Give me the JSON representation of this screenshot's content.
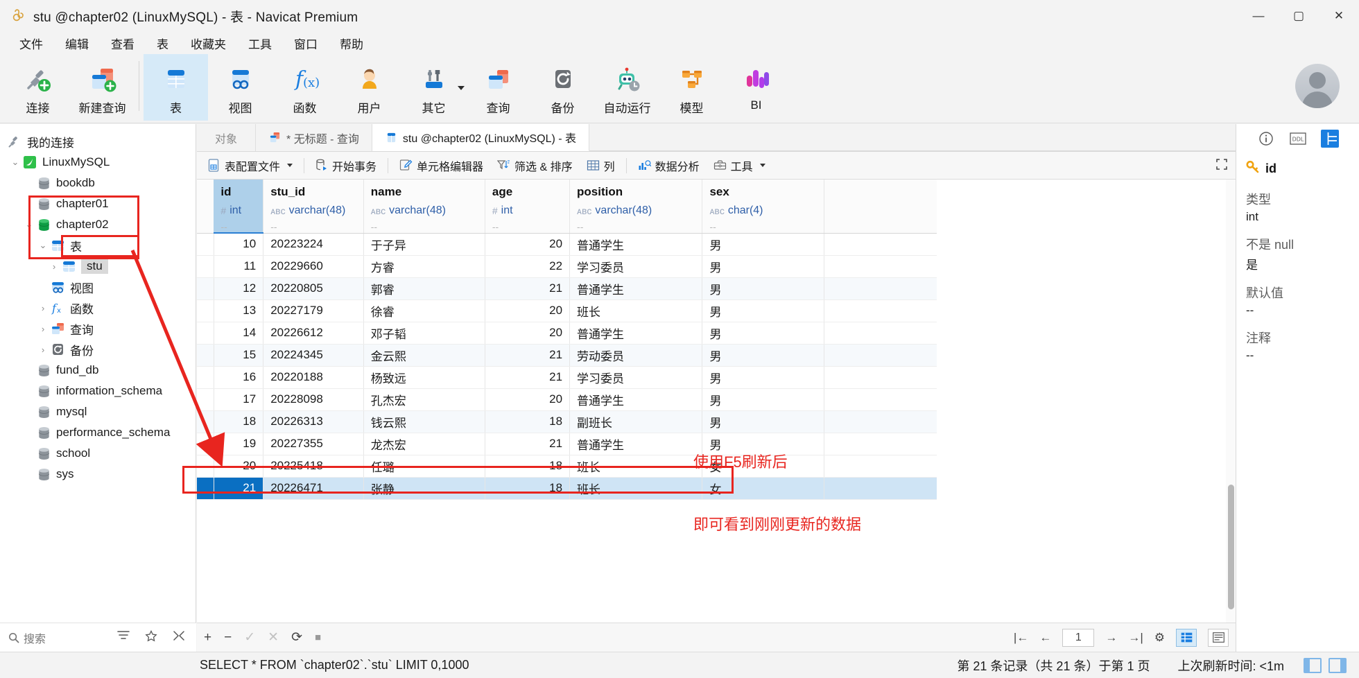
{
  "window": {
    "title": "stu @chapter02 (LinuxMySQL) - 表 - Navicat Premium",
    "minimize": "—",
    "maximize": "▢",
    "close": "✕"
  },
  "menubar": [
    "文件",
    "编辑",
    "查看",
    "表",
    "收藏夹",
    "工具",
    "窗口",
    "帮助"
  ],
  "toolbar": [
    {
      "label": "连接",
      "icon": "connection-add-icon"
    },
    {
      "label": "新建查询",
      "icon": "new-query-icon"
    },
    {
      "label": "表",
      "icon": "table-icon",
      "active": true
    },
    {
      "label": "视图",
      "icon": "view-icon"
    },
    {
      "label": "函数",
      "icon": "function-icon"
    },
    {
      "label": "用户",
      "icon": "user-icon"
    },
    {
      "label": "其它",
      "icon": "others-icon",
      "caret": true
    },
    {
      "label": "查询",
      "icon": "query-icon"
    },
    {
      "label": "备份",
      "icon": "backup-icon"
    },
    {
      "label": "自动运行",
      "icon": "automation-icon"
    },
    {
      "label": "模型",
      "icon": "model-icon"
    },
    {
      "label": "BI",
      "icon": "bi-icon"
    }
  ],
  "sidebar": {
    "root": "我的连接",
    "search_placeholder": "搜索",
    "tree": [
      {
        "label": "LinuxMySQL",
        "icon": "mysql-icon",
        "depth": 0,
        "arrow": "v"
      },
      {
        "label": "bookdb",
        "icon": "database-icon",
        "depth": 1,
        "arrow": ""
      },
      {
        "label": "chapter01",
        "icon": "database-icon",
        "depth": 1,
        "arrow": ""
      },
      {
        "label": "chapter02",
        "icon": "database-open-icon",
        "depth": 1,
        "arrow": "v"
      },
      {
        "label": "表",
        "icon": "table-folder-icon",
        "depth": 2,
        "arrow": "v"
      },
      {
        "label": "stu",
        "icon": "table-icon",
        "depth": 3,
        "arrow": ">",
        "selected": true
      },
      {
        "label": "视图",
        "icon": "view-folder-icon",
        "depth": 2,
        "arrow": ""
      },
      {
        "label": "函数",
        "icon": "function-folder-icon",
        "depth": 2,
        "arrow": ">"
      },
      {
        "label": "查询",
        "icon": "query-folder-icon",
        "depth": 2,
        "arrow": ">"
      },
      {
        "label": "备份",
        "icon": "backup-folder-icon",
        "depth": 2,
        "arrow": ">"
      },
      {
        "label": "fund_db",
        "icon": "database-icon",
        "depth": 1,
        "arrow": ""
      },
      {
        "label": "information_schema",
        "icon": "database-icon",
        "depth": 1,
        "arrow": ""
      },
      {
        "label": "mysql",
        "icon": "database-icon",
        "depth": 1,
        "arrow": ""
      },
      {
        "label": "performance_schema",
        "icon": "database-icon",
        "depth": 1,
        "arrow": ""
      },
      {
        "label": "school",
        "icon": "database-icon",
        "depth": 1,
        "arrow": ""
      },
      {
        "label": "sys",
        "icon": "database-icon",
        "depth": 1,
        "arrow": ""
      }
    ]
  },
  "doc_tabs": [
    {
      "label": "对象",
      "icon": "",
      "active": false
    },
    {
      "label": "* 无标题 - 查询",
      "icon": "query-icon",
      "active": false
    },
    {
      "label": "stu @chapter02 (LinuxMySQL) - 表",
      "icon": "table-icon",
      "active": true
    }
  ],
  "grid_toolbar": [
    {
      "label": "表配置文件",
      "icon": "profile-icon",
      "caret": true
    },
    {
      "label": "开始事务",
      "icon": "transaction-icon"
    },
    {
      "label": "单元格编辑器",
      "icon": "pencil-icon"
    },
    {
      "label": "筛选 & 排序",
      "icon": "filter-sort-icon"
    },
    {
      "label": "列",
      "icon": "columns-icon"
    },
    {
      "label": "数据分析",
      "icon": "chart-icon"
    },
    {
      "label": "工具",
      "icon": "toolbox-icon",
      "caret": true
    }
  ],
  "table": {
    "columns": [
      {
        "name": "id",
        "type": "int",
        "type_icon": "hash",
        "default": "--",
        "selected": true
      },
      {
        "name": "stu_id",
        "type": "varchar(48)",
        "type_icon": "abc",
        "default": "--"
      },
      {
        "name": "name",
        "type": "varchar(48)",
        "type_icon": "abc",
        "default": "--"
      },
      {
        "name": "age",
        "type": "int",
        "type_icon": "hash",
        "default": "--"
      },
      {
        "name": "position",
        "type": "varchar(48)",
        "type_icon": "abc",
        "default": "--"
      },
      {
        "name": "sex",
        "type": "char(4)",
        "type_icon": "abc",
        "default": "--"
      }
    ],
    "rows": [
      {
        "id": "10",
        "stu_id": "20223224",
        "name": "于子异",
        "age": "20",
        "position": "普通学生",
        "sex": "男"
      },
      {
        "id": "11",
        "stu_id": "20229660",
        "name": "方睿",
        "age": "22",
        "position": "学习委员",
        "sex": "男"
      },
      {
        "id": "12",
        "stu_id": "20220805",
        "name": "郭睿",
        "age": "21",
        "position": "普通学生",
        "sex": "男"
      },
      {
        "id": "13",
        "stu_id": "20227179",
        "name": "徐睿",
        "age": "20",
        "position": "班长",
        "sex": "男"
      },
      {
        "id": "14",
        "stu_id": "20226612",
        "name": "邓子韬",
        "age": "20",
        "position": "普通学生",
        "sex": "男"
      },
      {
        "id": "15",
        "stu_id": "20224345",
        "name": "金云熙",
        "age": "21",
        "position": "劳动委员",
        "sex": "男"
      },
      {
        "id": "16",
        "stu_id": "20220188",
        "name": "杨致远",
        "age": "21",
        "position": "学习委员",
        "sex": "男"
      },
      {
        "id": "17",
        "stu_id": "20228098",
        "name": "孔杰宏",
        "age": "20",
        "position": "普通学生",
        "sex": "男"
      },
      {
        "id": "18",
        "stu_id": "20226313",
        "name": "钱云熙",
        "age": "18",
        "position": "副班长",
        "sex": "男"
      },
      {
        "id": "19",
        "stu_id": "20227355",
        "name": "龙杰宏",
        "age": "21",
        "position": "普通学生",
        "sex": "男"
      },
      {
        "id": "20",
        "stu_id": "20225418",
        "name": "任璐",
        "age": "18",
        "position": "班长",
        "sex": "女"
      },
      {
        "id": "21",
        "stu_id": "20226471",
        "name": "张静",
        "age": "18",
        "position": "班长",
        "sex": "女",
        "selected": true
      }
    ]
  },
  "grid_footer": {
    "add": "+",
    "remove": "−",
    "confirm": "✓",
    "cancel": "✕",
    "refresh": "⟳",
    "stop": "■",
    "first": "|←",
    "prev": "←",
    "page": "1",
    "next": "→",
    "last": "→|",
    "settings": "⚙",
    "grid_view": "grid-view-icon",
    "form_view": "form-view-icon"
  },
  "right_panel": {
    "tabs": [
      {
        "icon": "info-icon",
        "active": false
      },
      {
        "icon": "ddl-icon",
        "active": false
      },
      {
        "icon": "fields-icon",
        "active": true
      }
    ],
    "field_name": "id",
    "field_icon": "key-icon",
    "props": [
      {
        "label": "类型",
        "value": "int"
      },
      {
        "label": "不是 null",
        "value": "是"
      },
      {
        "label": "默认值",
        "value": "--"
      },
      {
        "label": "注释",
        "value": "--"
      }
    ]
  },
  "statusbar": {
    "sql": "SELECT * FROM `chapter02`.`stu` LIMIT 0,1000",
    "records": "第 21 条记录（共 21 条）于第 1 页",
    "refresh_time": "上次刷新时间: <1m"
  },
  "annotations": {
    "note_line1": "使用F5刷新后",
    "note_line2": "即可看到刚刚更新的数据",
    "color": "#e8251f"
  }
}
